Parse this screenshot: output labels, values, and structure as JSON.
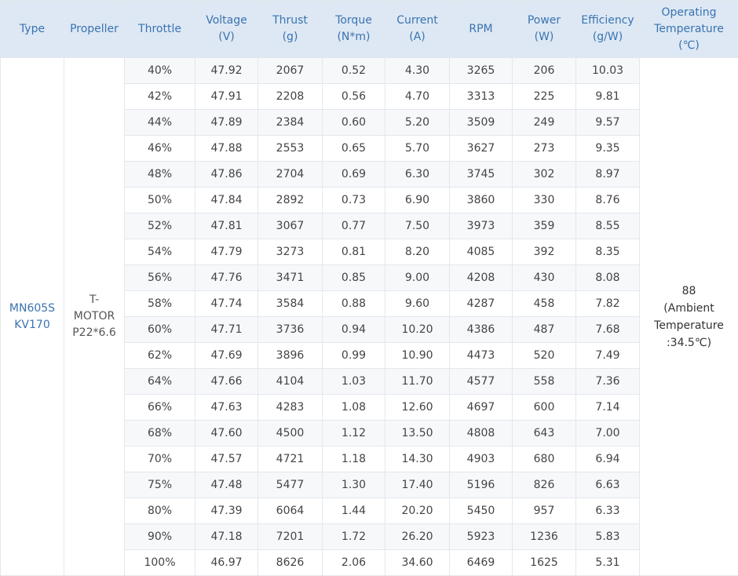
{
  "headers": [
    {
      "lines": [
        "Type"
      ]
    },
    {
      "lines": [
        "Propeller"
      ]
    },
    {
      "lines": [
        "Throttle"
      ]
    },
    {
      "lines": [
        "Voltage",
        "(V)"
      ]
    },
    {
      "lines": [
        "Thrust",
        "(g)"
      ]
    },
    {
      "lines": [
        "Torque",
        "(N*m)"
      ]
    },
    {
      "lines": [
        "Current",
        "(A)"
      ]
    },
    {
      "lines": [
        "RPM"
      ]
    },
    {
      "lines": [
        "Power",
        "(W)"
      ]
    },
    {
      "lines": [
        "Efficiency",
        "(g/W)"
      ]
    },
    {
      "lines": [
        "Operating",
        "Temperature",
        "(℃)"
      ]
    }
  ],
  "type_lines": [
    "MN605S",
    "KV170"
  ],
  "propeller_lines": [
    "T-",
    "MOTOR",
    "P22*6.6"
  ],
  "temperature_lines": [
    "88",
    "(Ambient",
    "Temperature",
    ":34.5℃)"
  ],
  "rows": [
    [
      "40%",
      "47.92",
      "2067",
      "0.52",
      "4.30",
      "3265",
      "206",
      "10.03"
    ],
    [
      "42%",
      "47.91",
      "2208",
      "0.56",
      "4.70",
      "3313",
      "225",
      "9.81"
    ],
    [
      "44%",
      "47.89",
      "2384",
      "0.60",
      "5.20",
      "3509",
      "249",
      "9.57"
    ],
    [
      "46%",
      "47.88",
      "2553",
      "0.65",
      "5.70",
      "3627",
      "273",
      "9.35"
    ],
    [
      "48%",
      "47.86",
      "2704",
      "0.69",
      "6.30",
      "3745",
      "302",
      "8.97"
    ],
    [
      "50%",
      "47.84",
      "2892",
      "0.73",
      "6.90",
      "3860",
      "330",
      "8.76"
    ],
    [
      "52%",
      "47.81",
      "3067",
      "0.77",
      "7.50",
      "3973",
      "359",
      "8.55"
    ],
    [
      "54%",
      "47.79",
      "3273",
      "0.81",
      "8.20",
      "4085",
      "392",
      "8.35"
    ],
    [
      "56%",
      "47.76",
      "3471",
      "0.85",
      "9.00",
      "4208",
      "430",
      "8.08"
    ],
    [
      "58%",
      "47.74",
      "3584",
      "0.88",
      "9.60",
      "4287",
      "458",
      "7.82"
    ],
    [
      "60%",
      "47.71",
      "3736",
      "0.94",
      "10.20",
      "4386",
      "487",
      "7.68"
    ],
    [
      "62%",
      "47.69",
      "3896",
      "0.99",
      "10.90",
      "4473",
      "520",
      "7.49"
    ],
    [
      "64%",
      "47.66",
      "4104",
      "1.03",
      "11.70",
      "4577",
      "558",
      "7.36"
    ],
    [
      "66%",
      "47.63",
      "4283",
      "1.08",
      "12.60",
      "4697",
      "600",
      "7.14"
    ],
    [
      "68%",
      "47.60",
      "4500",
      "1.12",
      "13.50",
      "4808",
      "643",
      "7.00"
    ],
    [
      "70%",
      "47.57",
      "4721",
      "1.18",
      "14.30",
      "4903",
      "680",
      "6.94"
    ],
    [
      "75%",
      "47.48",
      "5477",
      "1.30",
      "17.40",
      "5196",
      "826",
      "6.63"
    ],
    [
      "80%",
      "47.39",
      "6064",
      "1.44",
      "20.20",
      "5450",
      "957",
      "6.33"
    ],
    [
      "90%",
      "47.18",
      "7201",
      "1.72",
      "26.20",
      "5923",
      "1236",
      "5.83"
    ],
    [
      "100%",
      "46.97",
      "8626",
      "2.06",
      "34.60",
      "6469",
      "1625",
      "5.31"
    ]
  ]
}
